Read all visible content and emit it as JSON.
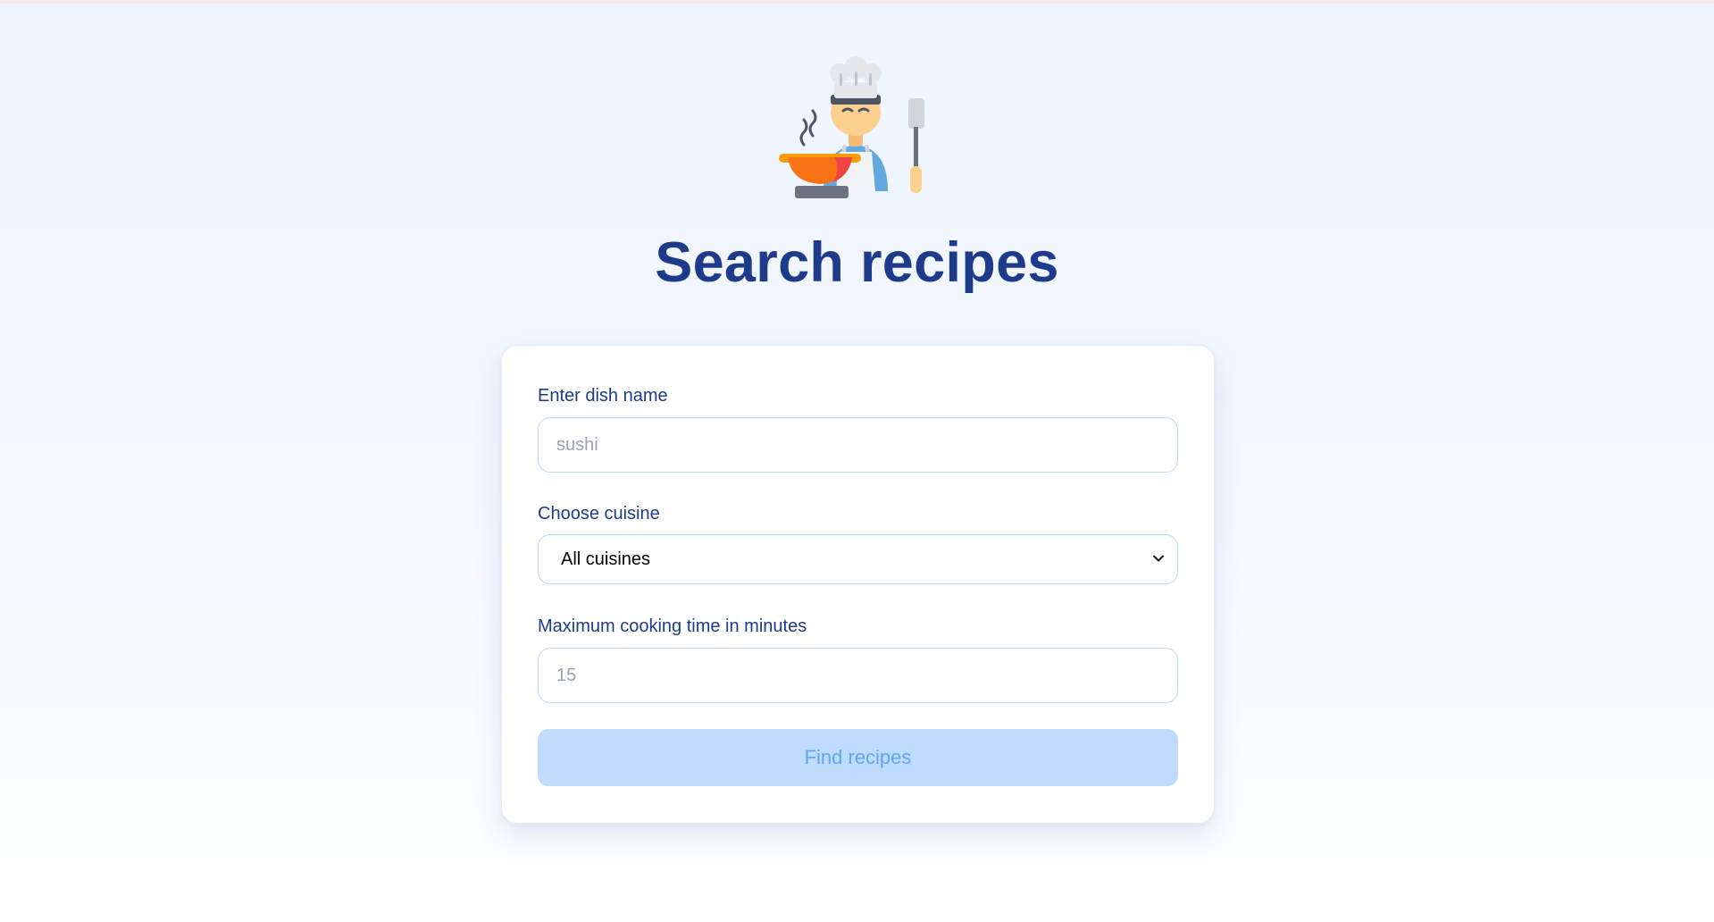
{
  "header": {
    "logo_icon": "chef-cooking-icon",
    "title": "Search recipes"
  },
  "form": {
    "dish": {
      "label": "Enter dish name",
      "placeholder": "sushi",
      "value": ""
    },
    "cuisine": {
      "label": "Choose cuisine",
      "selected": "All cuisines"
    },
    "time": {
      "label": "Maximum cooking time in minutes",
      "placeholder": "15",
      "value": ""
    },
    "submit_label": "Find recipes"
  },
  "colors": {
    "title": "#1e3a8a",
    "label": "#1e3a8a",
    "input_border": "#bfd6fb",
    "button_bg": "#bfdbfe",
    "button_text": "#60a5fa",
    "background_top": "#eef5ff"
  }
}
